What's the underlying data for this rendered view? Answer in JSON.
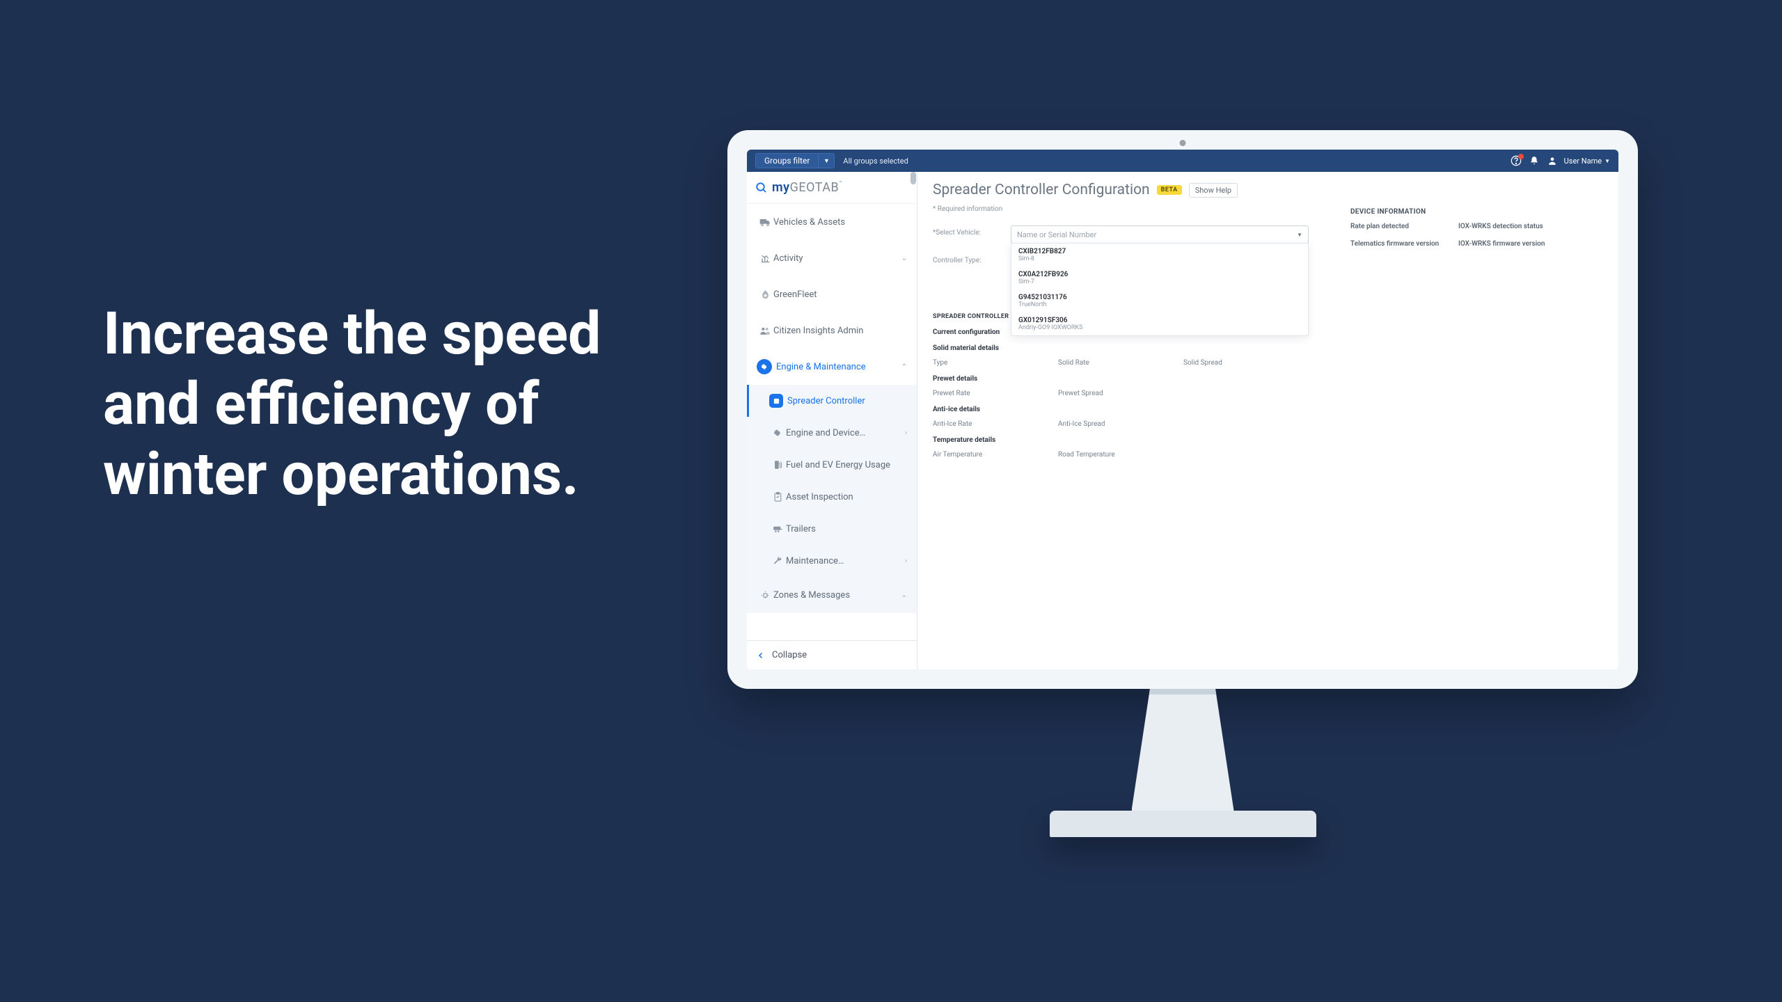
{
  "marketing_headline": "Increase the speed and efficiency of winter operations.",
  "topbar": {
    "groups_filter": "Groups filter",
    "all_groups": "All groups selected",
    "user_name": "User Name"
  },
  "brand": {
    "left": "my",
    "right": "GEOTAB"
  },
  "nav": {
    "vehicles": "Vehicles & Assets",
    "activity": "Activity",
    "greenfleet": "GreenFleet",
    "citizen": "Citizen Insights Admin",
    "engine": "Engine & Maintenance",
    "sub": {
      "spreader": "Spreader Controller",
      "enginedev": "Engine and Device…",
      "fuel": "Fuel and EV Energy Usage",
      "asset": "Asset Inspection",
      "trailers": "Trailers",
      "maint": "Maintenance…"
    },
    "zones": "Zones & Messages",
    "collapse": "Collapse"
  },
  "page": {
    "title": "Spreader Controller Configuration",
    "beta": "BETA",
    "show_help": "Show Help",
    "required": "* Required information",
    "select_vehicle": "*Select Vehicle:",
    "select_placeholder": "Name or Serial Number",
    "controller_type": "Controller Type:",
    "device_info": "DEVICE INFORMATION",
    "rate_plan": "Rate plan detected",
    "iox_det": "IOX-WRKS detection status",
    "tele_fw": "Telematics firmware version",
    "iox_fw": "IOX-WRKS firmware version",
    "spreader_ctrl": "SPREADER CONTROLLER",
    "current_config": "Current configuration",
    "solid_hdr": "Solid material details",
    "type": "Type",
    "solid_rate": "Solid Rate",
    "solid_spread": "Solid Spread",
    "prewet_hdr": "Prewet details",
    "prewet_rate": "Prewet Rate",
    "prewet_spread": "Prewet Spread",
    "antiice_hdr": "Anti-ice details",
    "antiice_rate": "Anti-Ice Rate",
    "antiice_spread": "Anti-Ice Spread",
    "temp_hdr": "Temperature details",
    "air_temp": "Air Temperature",
    "road_temp": "Road Temperature"
  },
  "dropdown": [
    {
      "a": "CXIB212FB827",
      "b": "Sim-8"
    },
    {
      "a": "CX0A212FB926",
      "b": "Sim-7"
    },
    {
      "a": "G94521031176",
      "b": "TrueNorth"
    },
    {
      "a": "GX01291SF306",
      "b": "Andriy-GO9 IOXWORKS"
    }
  ]
}
